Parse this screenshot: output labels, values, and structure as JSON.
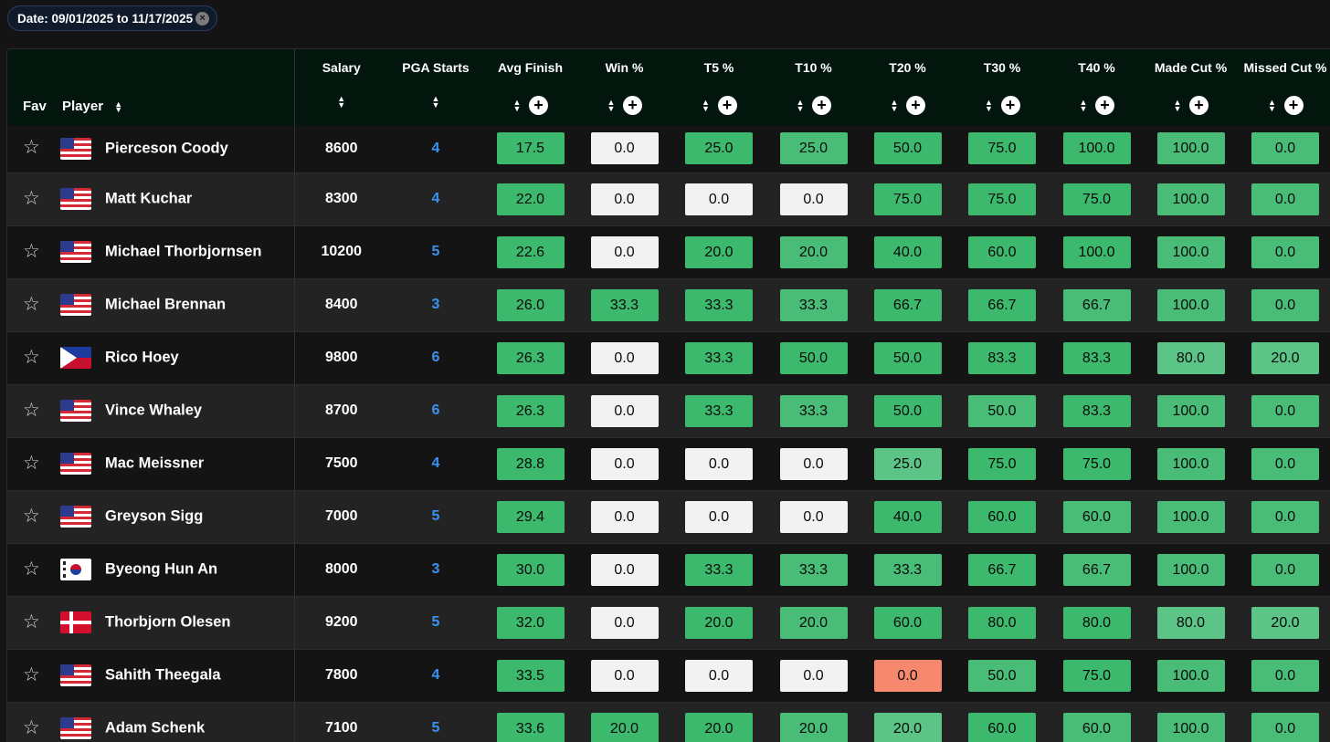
{
  "filter": {
    "date_label": "Date: 09/01/2025 to 11/17/2025",
    "clear_icon": "close-icon"
  },
  "columns": {
    "fav": "Fav",
    "player": "Player",
    "salary": "Salary",
    "starts": "PGA Starts",
    "stats": [
      "Avg Finish",
      "Win %",
      "T5 %",
      "T10 %",
      "T20 %",
      "T30 %",
      "T40 %",
      "Made Cut %",
      "Missed Cut %"
    ]
  },
  "colors": {
    "green_strong": "#3cb96c",
    "green_mid": "#49bd77",
    "green_light": "#5cc486",
    "neutral": "#f2f2f2",
    "negative": "#f78870",
    "starts_link": "#3b93f0",
    "header_bg": "#03160e"
  },
  "rows": [
    {
      "name": "Pierceson Coody",
      "flag": "us",
      "salary": "8600",
      "starts": "4",
      "stats": [
        [
          "17.5",
          "g1"
        ],
        [
          "0.0",
          "w"
        ],
        [
          "25.0",
          "g1"
        ],
        [
          "25.0",
          "g2"
        ],
        [
          "50.0",
          "g1"
        ],
        [
          "75.0",
          "g1"
        ],
        [
          "100.0",
          "g1"
        ],
        [
          "100.0",
          "g2"
        ],
        [
          "0.0",
          "g2"
        ]
      ]
    },
    {
      "name": "Matt Kuchar",
      "flag": "us",
      "salary": "8300",
      "starts": "4",
      "stats": [
        [
          "22.0",
          "g1"
        ],
        [
          "0.0",
          "w"
        ],
        [
          "0.0",
          "w"
        ],
        [
          "0.0",
          "w"
        ],
        [
          "75.0",
          "g1"
        ],
        [
          "75.0",
          "g1"
        ],
        [
          "75.0",
          "g1"
        ],
        [
          "100.0",
          "g2"
        ],
        [
          "0.0",
          "g2"
        ]
      ]
    },
    {
      "name": "Michael Thorbjornsen",
      "flag": "us",
      "salary": "10200",
      "starts": "5",
      "stats": [
        [
          "22.6",
          "g1"
        ],
        [
          "0.0",
          "w"
        ],
        [
          "20.0",
          "g1"
        ],
        [
          "20.0",
          "g2"
        ],
        [
          "40.0",
          "g1"
        ],
        [
          "60.0",
          "g1"
        ],
        [
          "100.0",
          "g1"
        ],
        [
          "100.0",
          "g2"
        ],
        [
          "0.0",
          "g2"
        ]
      ]
    },
    {
      "name": "Michael Brennan",
      "flag": "us",
      "salary": "8400",
      "starts": "3",
      "stats": [
        [
          "26.0",
          "g1"
        ],
        [
          "33.3",
          "g1"
        ],
        [
          "33.3",
          "g1"
        ],
        [
          "33.3",
          "g2"
        ],
        [
          "66.7",
          "g1"
        ],
        [
          "66.7",
          "g1"
        ],
        [
          "66.7",
          "g2"
        ],
        [
          "100.0",
          "g2"
        ],
        [
          "0.0",
          "g2"
        ]
      ]
    },
    {
      "name": "Rico Hoey",
      "flag": "ph",
      "salary": "9800",
      "starts": "6",
      "stats": [
        [
          "26.3",
          "g1"
        ],
        [
          "0.0",
          "w"
        ],
        [
          "33.3",
          "g1"
        ],
        [
          "50.0",
          "g1"
        ],
        [
          "50.0",
          "g1"
        ],
        [
          "83.3",
          "g1"
        ],
        [
          "83.3",
          "g1"
        ],
        [
          "80.0",
          "g3"
        ],
        [
          "20.0",
          "g3"
        ]
      ]
    },
    {
      "name": "Vince Whaley",
      "flag": "us",
      "salary": "8700",
      "starts": "6",
      "stats": [
        [
          "26.3",
          "g1"
        ],
        [
          "0.0",
          "w"
        ],
        [
          "33.3",
          "g1"
        ],
        [
          "33.3",
          "g2"
        ],
        [
          "50.0",
          "g1"
        ],
        [
          "50.0",
          "g2"
        ],
        [
          "83.3",
          "g1"
        ],
        [
          "100.0",
          "g2"
        ],
        [
          "0.0",
          "g2"
        ]
      ]
    },
    {
      "name": "Mac Meissner",
      "flag": "us",
      "salary": "7500",
      "starts": "4",
      "stats": [
        [
          "28.8",
          "g1"
        ],
        [
          "0.0",
          "w"
        ],
        [
          "0.0",
          "w"
        ],
        [
          "0.0",
          "w"
        ],
        [
          "25.0",
          "g3"
        ],
        [
          "75.0",
          "g1"
        ],
        [
          "75.0",
          "g1"
        ],
        [
          "100.0",
          "g2"
        ],
        [
          "0.0",
          "g2"
        ]
      ]
    },
    {
      "name": "Greyson Sigg",
      "flag": "us",
      "salary": "7000",
      "starts": "5",
      "stats": [
        [
          "29.4",
          "g1"
        ],
        [
          "0.0",
          "w"
        ],
        [
          "0.0",
          "w"
        ],
        [
          "0.0",
          "w"
        ],
        [
          "40.0",
          "g1"
        ],
        [
          "60.0",
          "g1"
        ],
        [
          "60.0",
          "g2"
        ],
        [
          "100.0",
          "g2"
        ],
        [
          "0.0",
          "g2"
        ]
      ]
    },
    {
      "name": "Byeong Hun An",
      "flag": "kr",
      "salary": "8000",
      "starts": "3",
      "stats": [
        [
          "30.0",
          "g1"
        ],
        [
          "0.0",
          "w"
        ],
        [
          "33.3",
          "g1"
        ],
        [
          "33.3",
          "g2"
        ],
        [
          "33.3",
          "g2"
        ],
        [
          "66.7",
          "g1"
        ],
        [
          "66.7",
          "g2"
        ],
        [
          "100.0",
          "g2"
        ],
        [
          "0.0",
          "g2"
        ]
      ]
    },
    {
      "name": "Thorbjorn Olesen",
      "flag": "dk",
      "salary": "9200",
      "starts": "5",
      "stats": [
        [
          "32.0",
          "g1"
        ],
        [
          "0.0",
          "w"
        ],
        [
          "20.0",
          "g1"
        ],
        [
          "20.0",
          "g2"
        ],
        [
          "60.0",
          "g1"
        ],
        [
          "80.0",
          "g1"
        ],
        [
          "80.0",
          "g1"
        ],
        [
          "80.0",
          "g3"
        ],
        [
          "20.0",
          "g3"
        ]
      ]
    },
    {
      "name": "Sahith Theegala",
      "flag": "us",
      "salary": "7800",
      "starts": "4",
      "stats": [
        [
          "33.5",
          "g1"
        ],
        [
          "0.0",
          "w"
        ],
        [
          "0.0",
          "w"
        ],
        [
          "0.0",
          "w"
        ],
        [
          "0.0",
          "r"
        ],
        [
          "50.0",
          "g2"
        ],
        [
          "75.0",
          "g1"
        ],
        [
          "100.0",
          "g2"
        ],
        [
          "0.0",
          "g2"
        ]
      ]
    },
    {
      "name": "Adam Schenk",
      "flag": "us",
      "salary": "7100",
      "starts": "5",
      "stats": [
        [
          "33.6",
          "g1"
        ],
        [
          "20.0",
          "g1"
        ],
        [
          "20.0",
          "g1"
        ],
        [
          "20.0",
          "g2"
        ],
        [
          "20.0",
          "g3"
        ],
        [
          "60.0",
          "g1"
        ],
        [
          "60.0",
          "g2"
        ],
        [
          "100.0",
          "g2"
        ],
        [
          "0.0",
          "g2"
        ]
      ]
    }
  ]
}
